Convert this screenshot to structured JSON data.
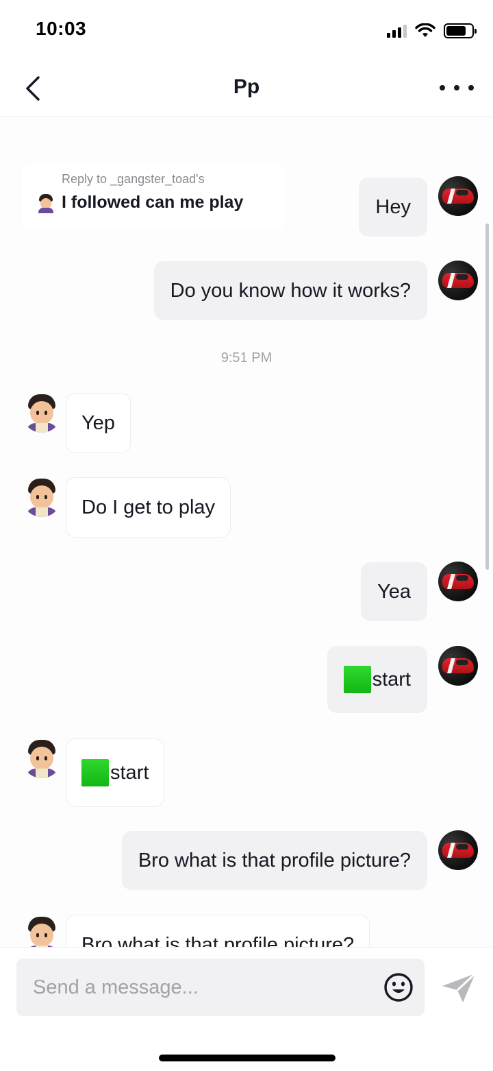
{
  "status_bar": {
    "time": "10:03"
  },
  "header": {
    "title": "Pp"
  },
  "reply": {
    "label": "Reply to _gangster_toad's",
    "text": "I followed can me play"
  },
  "messages": [
    {
      "from": "me",
      "text": "Hey"
    },
    {
      "from": "me",
      "text": "Do you know how it works?"
    },
    {
      "from": "them",
      "text": "Yep"
    },
    {
      "from": "them",
      "text": "Do I get to play"
    },
    {
      "from": "me",
      "text": "Yea"
    },
    {
      "from": "me",
      "text": "start",
      "prefix_icon": "green-square-icon"
    },
    {
      "from": "them",
      "text": "start",
      "prefix_icon": "green-square-icon"
    },
    {
      "from": "me",
      "text": "Bro what is that profile picture?"
    },
    {
      "from": "them",
      "text": "Bro what is that profile picture?"
    }
  ],
  "timestamp": "9:51 PM",
  "composer": {
    "placeholder": "Send a message..."
  },
  "colors": {
    "my_bubble": "#f1f1f3",
    "their_bubble": "#ffffff",
    "accent_green": "#19c219",
    "send_icon": "#b8b9bd"
  }
}
